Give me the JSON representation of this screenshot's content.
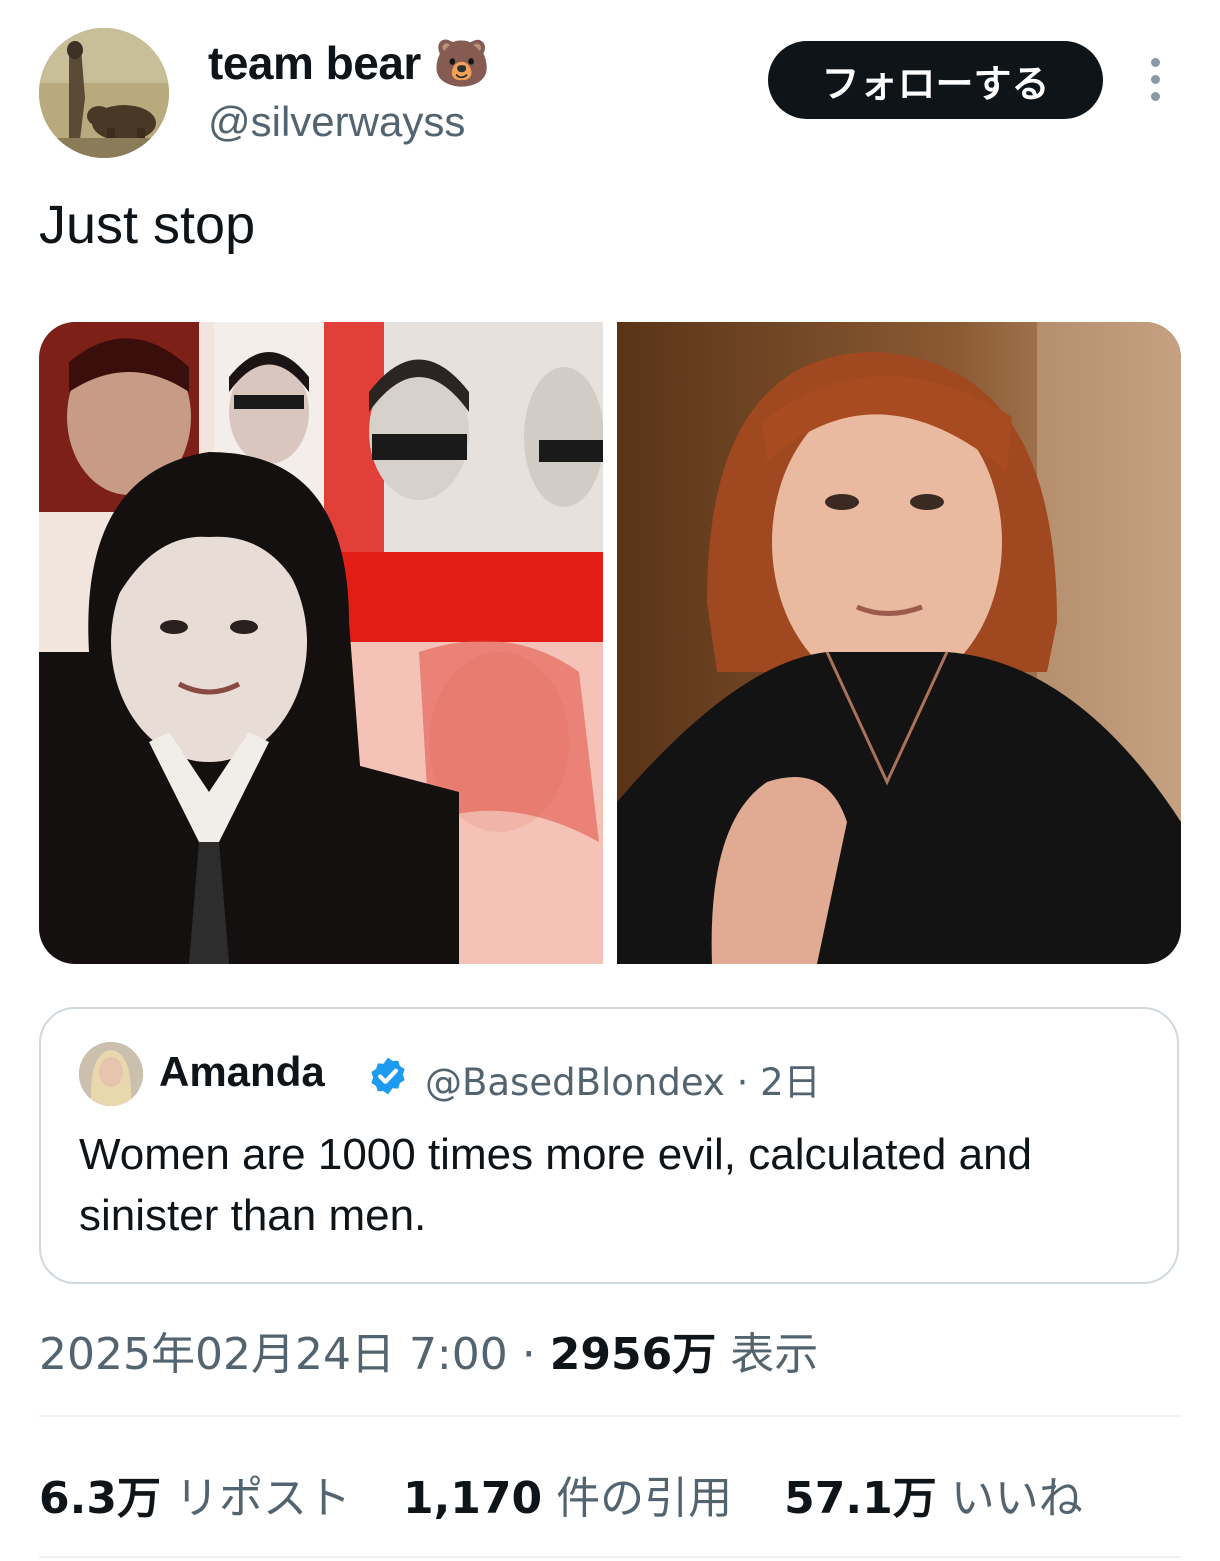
{
  "author": {
    "display_name": "team bear",
    "name_emoji": "🐻",
    "handle": "@silverwayss"
  },
  "follow_button": "フォローする",
  "tweet_text": "Just stop",
  "quoted_tweet": {
    "display_name": "Amanda",
    "handle_time": "@BasedBlondex · 2日",
    "text": "Women are 1000 times more evil, calculated and sinister than men."
  },
  "meta": {
    "timestamp": "2025年02月24日 7:00",
    "separator": "·",
    "views_count": "2956万",
    "views_label": "表示"
  },
  "stats": {
    "reposts_count": "6.3万",
    "reposts_label": "リポスト",
    "quotes_count": "1,170",
    "quotes_label": "件の引用",
    "likes_count": "57.1万",
    "likes_label": "いいね"
  },
  "colors": {
    "text": "#0f1419",
    "secondary": "#536471",
    "verified": "#1d9bf0",
    "border": "#cfd9de"
  }
}
